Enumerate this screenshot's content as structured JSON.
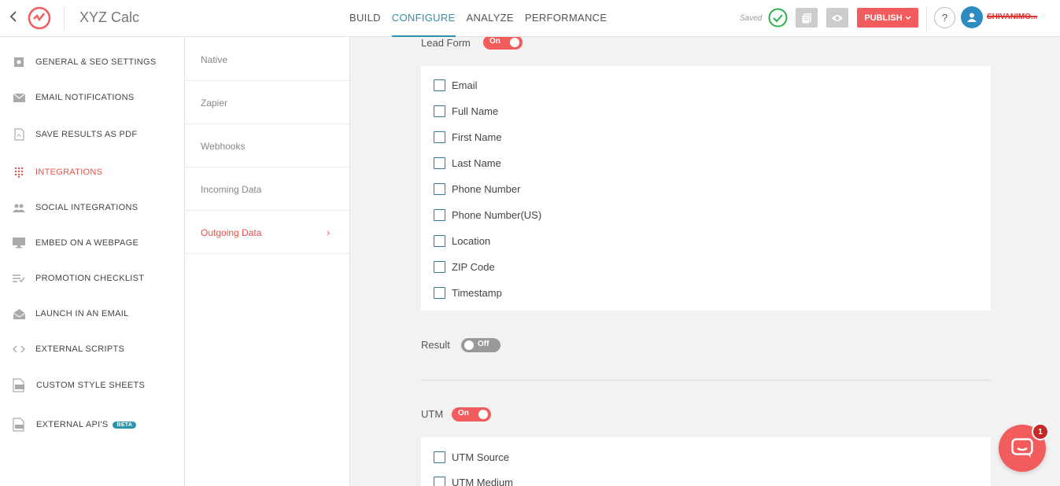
{
  "header": {
    "app_name": "XYZ Calc",
    "nav": [
      "BUILD",
      "CONFIGURE",
      "ANALYZE",
      "PERFORMANCE"
    ],
    "active_nav": "CONFIGURE",
    "saved_label": "Saved",
    "publish_label": "PUBLISH",
    "help_label": "?",
    "username": "SHIVANIMO..."
  },
  "sidebar": {
    "items": [
      {
        "label": "GENERAL & SEO SETTINGS",
        "icon": "settings-icon"
      },
      {
        "label": "EMAIL NOTIFICATIONS",
        "icon": "envelope-icon"
      },
      {
        "label": "SAVE RESULTS AS PDF",
        "icon": "pdf-icon"
      },
      {
        "label": "INTEGRATIONS",
        "icon": "grid-dots-icon"
      },
      {
        "label": "SOCIAL INTEGRATIONS",
        "icon": "people-icon"
      },
      {
        "label": "EMBED ON A WEBPAGE",
        "icon": "monitor-icon"
      },
      {
        "label": "PROMOTION CHECKLIST",
        "icon": "checklist-icon"
      },
      {
        "label": "LAUNCH IN AN EMAIL",
        "icon": "open-envelope-icon"
      },
      {
        "label": "EXTERNAL SCRIPTS",
        "icon": "code-icon"
      },
      {
        "label": "CUSTOM STYLE SHEETS",
        "icon": "css-file-icon"
      },
      {
        "label": "EXTERNAL API'S",
        "icon": "api-file-icon",
        "badge": "BETA"
      }
    ],
    "active": "INTEGRATIONS"
  },
  "subnav": {
    "items": [
      "Native",
      "Zapier",
      "Webhooks",
      "Incoming Data",
      "Outgoing Data"
    ],
    "active": "Outgoing Data",
    "active_chevron": "›"
  },
  "main": {
    "lead_form": {
      "label": "Lead Form",
      "toggle": "On",
      "fields": [
        "Email",
        "Full Name",
        "First Name",
        "Last Name",
        "Phone Number",
        "Phone Number(US)",
        "Location",
        "ZIP Code",
        "Timestamp"
      ]
    },
    "result": {
      "label": "Result",
      "toggle": "Off"
    },
    "utm": {
      "label": "UTM",
      "toggle": "On",
      "fields": [
        "UTM Source",
        "UTM Medium"
      ]
    }
  },
  "chat": {
    "badge_count": "1"
  },
  "colors": {
    "accent": "#f25c5c",
    "nav_active": "#2d93ad",
    "sidebar_active": "#e5534b"
  }
}
